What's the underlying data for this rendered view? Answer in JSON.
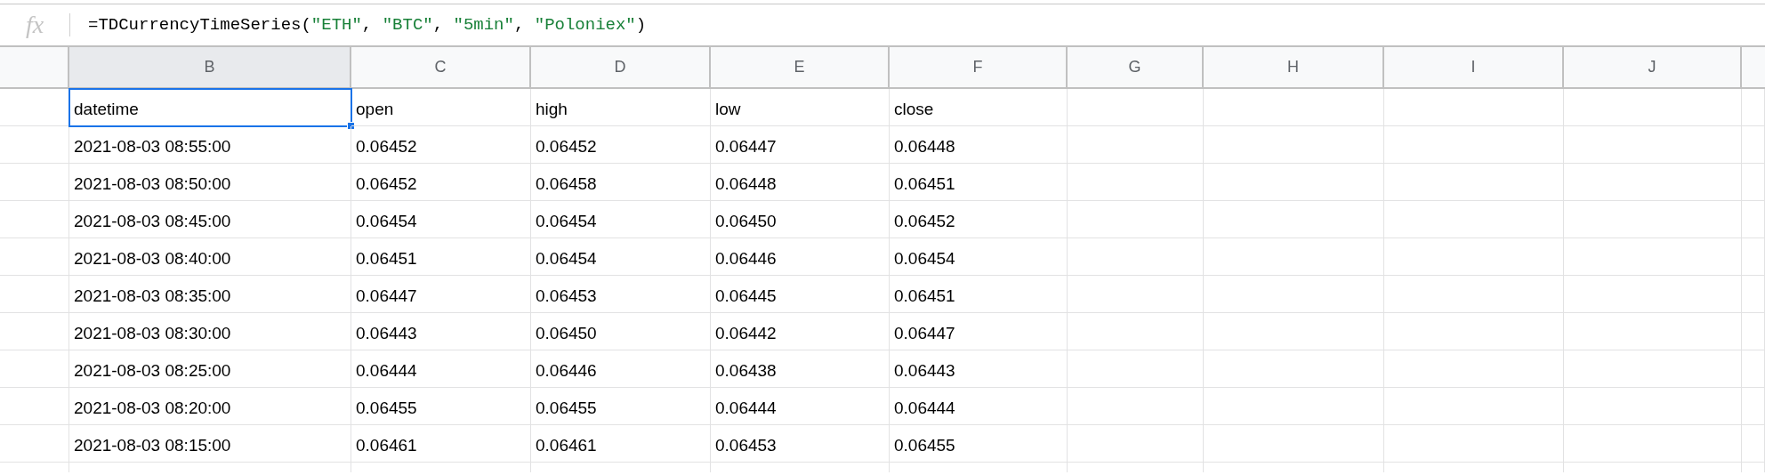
{
  "formula_bar": {
    "icon": "fx",
    "segments": [
      {
        "text": "=TDCurrencyTimeSeries(",
        "kind": "code"
      },
      {
        "text": "\"ETH\"",
        "kind": "string"
      },
      {
        "text": ", ",
        "kind": "code"
      },
      {
        "text": "\"BTC\"",
        "kind": "string"
      },
      {
        "text": ", ",
        "kind": "code"
      },
      {
        "text": "\"5min\"",
        "kind": "string"
      },
      {
        "text": ", ",
        "kind": "code"
      },
      {
        "text": "\"Poloniex\"",
        "kind": "string"
      },
      {
        "text": ")",
        "kind": "code"
      }
    ]
  },
  "columns": [
    {
      "label": "B",
      "selected": true
    },
    {
      "label": "C",
      "selected": false
    },
    {
      "label": "D",
      "selected": false
    },
    {
      "label": "E",
      "selected": false
    },
    {
      "label": "F",
      "selected": false
    },
    {
      "label": "G",
      "selected": false
    },
    {
      "label": "H",
      "selected": false
    },
    {
      "label": "I",
      "selected": false
    },
    {
      "label": "J",
      "selected": false
    }
  ],
  "rows": [
    [
      {
        "text": "datetime",
        "selected": true
      },
      {
        "text": "open",
        "selected": false
      },
      {
        "text": "high",
        "selected": false
      },
      {
        "text": "low",
        "selected": false
      },
      {
        "text": "close",
        "selected": false
      }
    ],
    [
      {
        "text": "2021-08-03 08:55:00",
        "selected": false
      },
      {
        "text": "0.06452",
        "selected": false
      },
      {
        "text": "0.06452",
        "selected": false
      },
      {
        "text": "0.06447",
        "selected": false
      },
      {
        "text": "0.06448",
        "selected": false
      }
    ],
    [
      {
        "text": "2021-08-03 08:50:00",
        "selected": false
      },
      {
        "text": "0.06452",
        "selected": false
      },
      {
        "text": "0.06458",
        "selected": false
      },
      {
        "text": "0.06448",
        "selected": false
      },
      {
        "text": "0.06451",
        "selected": false
      }
    ],
    [
      {
        "text": "2021-08-03 08:45:00",
        "selected": false
      },
      {
        "text": "0.06454",
        "selected": false
      },
      {
        "text": "0.06454",
        "selected": false
      },
      {
        "text": "0.06450",
        "selected": false
      },
      {
        "text": "0.06452",
        "selected": false
      }
    ],
    [
      {
        "text": "2021-08-03 08:40:00",
        "selected": false
      },
      {
        "text": "0.06451",
        "selected": false
      },
      {
        "text": "0.06454",
        "selected": false
      },
      {
        "text": "0.06446",
        "selected": false
      },
      {
        "text": "0.06454",
        "selected": false
      }
    ],
    [
      {
        "text": "2021-08-03 08:35:00",
        "selected": false
      },
      {
        "text": "0.06447",
        "selected": false
      },
      {
        "text": "0.06453",
        "selected": false
      },
      {
        "text": "0.06445",
        "selected": false
      },
      {
        "text": "0.06451",
        "selected": false
      }
    ],
    [
      {
        "text": "2021-08-03 08:30:00",
        "selected": false
      },
      {
        "text": "0.06443",
        "selected": false
      },
      {
        "text": "0.06450",
        "selected": false
      },
      {
        "text": "0.06442",
        "selected": false
      },
      {
        "text": "0.06447",
        "selected": false
      }
    ],
    [
      {
        "text": "2021-08-03 08:25:00",
        "selected": false
      },
      {
        "text": "0.06444",
        "selected": false
      },
      {
        "text": "0.06446",
        "selected": false
      },
      {
        "text": "0.06438",
        "selected": false
      },
      {
        "text": "0.06443",
        "selected": false
      }
    ],
    [
      {
        "text": "2021-08-03 08:20:00",
        "selected": false
      },
      {
        "text": "0.06455",
        "selected": false
      },
      {
        "text": "0.06455",
        "selected": false
      },
      {
        "text": "0.06444",
        "selected": false
      },
      {
        "text": "0.06444",
        "selected": false
      }
    ],
    [
      {
        "text": "2021-08-03 08:15:00",
        "selected": false
      },
      {
        "text": "0.06461",
        "selected": false
      },
      {
        "text": "0.06461",
        "selected": false
      },
      {
        "text": "0.06453",
        "selected": false
      },
      {
        "text": "0.06455",
        "selected": false
      }
    ]
  ]
}
